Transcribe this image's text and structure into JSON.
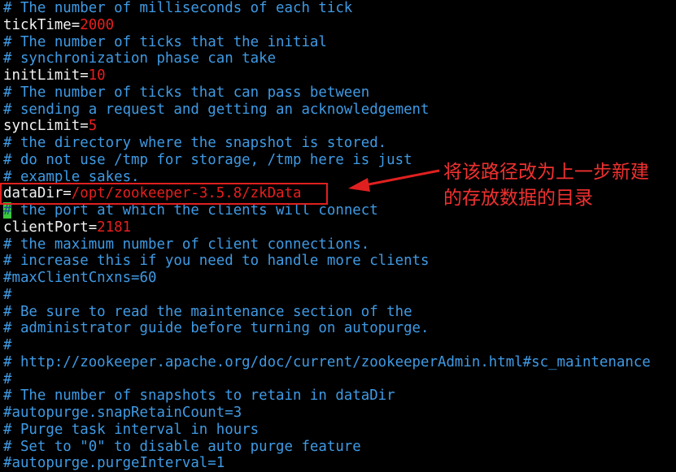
{
  "editor": {
    "lines": [
      {
        "type": "comment",
        "text": "# The number of milliseconds of each tick"
      },
      {
        "type": "kv",
        "key": "tickTime=",
        "value": "2000"
      },
      {
        "type": "comment",
        "text": "# The number of ticks that the initial"
      },
      {
        "type": "comment",
        "text": "# synchronization phase can take"
      },
      {
        "type": "kv",
        "key": "initLimit=",
        "value": "10"
      },
      {
        "type": "comment",
        "text": "# The number of ticks that can pass between"
      },
      {
        "type": "comment",
        "text": "# sending a request and getting an acknowledgement"
      },
      {
        "type": "kv",
        "key": "syncLimit=",
        "value": "5"
      },
      {
        "type": "comment",
        "text": "# the directory where the snapshot is stored."
      },
      {
        "type": "comment",
        "text": "# do not use /tmp for storage, /tmp here is just"
      },
      {
        "type": "comment",
        "text": "# example sakes."
      },
      {
        "type": "kv",
        "key": "dataDir=",
        "value": "/opt/zookeeper-3.5.8/zkData"
      },
      {
        "type": "cursor-comment",
        "hash": "#",
        "text": " the port at which the clients will connect"
      },
      {
        "type": "kv",
        "key": "clientPort=",
        "value": "2181"
      },
      {
        "type": "comment",
        "text": "# the maximum number of client connections."
      },
      {
        "type": "comment",
        "text": "# increase this if you need to handle more clients"
      },
      {
        "type": "comment",
        "text": "#maxClientCnxns=60"
      },
      {
        "type": "comment",
        "text": "#"
      },
      {
        "type": "comment",
        "text": "# Be sure to read the maintenance section of the"
      },
      {
        "type": "comment",
        "text": "# administrator guide before turning on autopurge."
      },
      {
        "type": "comment",
        "text": "#"
      },
      {
        "type": "comment",
        "text": "# http://zookeeper.apache.org/doc/current/zookeeperAdmin.html#sc_maintenance"
      },
      {
        "type": "comment",
        "text": "#"
      },
      {
        "type": "comment",
        "text": "# The number of snapshots to retain in dataDir"
      },
      {
        "type": "comment",
        "text": "#autopurge.snapRetainCount=3"
      },
      {
        "type": "comment",
        "text": "# Purge task interval in hours"
      },
      {
        "type": "comment",
        "text": "# Set to \"0\" to disable auto purge feature"
      },
      {
        "type": "comment",
        "text": "#autopurge.purgeInterval=1"
      }
    ]
  },
  "annotation": {
    "note": "将该路径改为上一步新建的存放数据的目录",
    "color": "#f03030"
  },
  "colors": {
    "background": "#000000",
    "comment": "#3f9ae4",
    "key": "#f2f2f2",
    "value": "#e81e1e",
    "cursor": "#3cc83c"
  }
}
